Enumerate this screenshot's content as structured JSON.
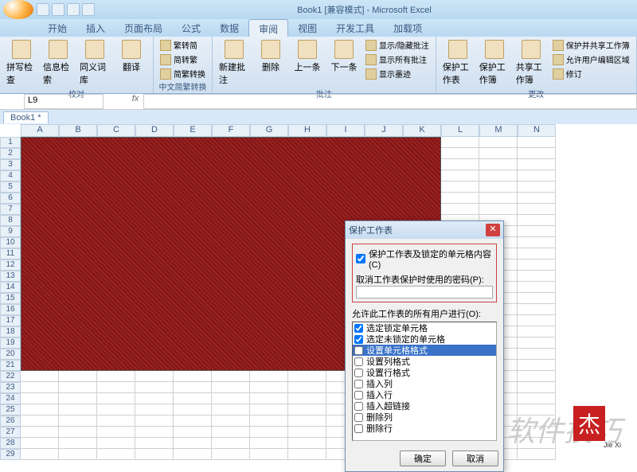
{
  "title": "Book1 [兼容模式] - Microsoft Excel",
  "tabs": [
    "开始",
    "插入",
    "页面布局",
    "公式",
    "数据",
    "审阅",
    "视图",
    "开发工具",
    "加载项"
  ],
  "active_tab": "审阅",
  "ribbon": {
    "group1": {
      "label": "校对",
      "btns": [
        "拼写检查",
        "信息检索",
        "同义词库",
        "翻译"
      ]
    },
    "group2": {
      "label": "中文简繁转换",
      "btns": [
        "繁转简",
        "简转繁",
        "简繁转换"
      ]
    },
    "group3": {
      "label": "批注",
      "big": [
        "新建批注",
        "删除",
        "上一条",
        "下一条"
      ],
      "small": [
        "显示/隐藏批注",
        "显示所有批注",
        "显示墨迹"
      ]
    },
    "group4": {
      "label": "更改",
      "big": [
        "保护工作表",
        "保护工作簿",
        "共享工作簿"
      ],
      "small": [
        "保护并共享工作簿",
        "允许用户编辑区域",
        "修订"
      ]
    }
  },
  "name_box": "L9",
  "workbook_tab": "Book1 *",
  "columns": [
    "A",
    "B",
    "C",
    "D",
    "E",
    "F",
    "G",
    "H",
    "I",
    "J",
    "K",
    "L",
    "M",
    "N"
  ],
  "rows": 29,
  "red_range": {
    "cols": 11,
    "rows": 21
  },
  "active_cell": "L9",
  "dialog": {
    "title": "保护工作表",
    "check_protect": "保护工作表及锁定的单元格内容(C)",
    "password_label": "取消工作表保护时使用的密码(P):",
    "allow_label": "允许此工作表的所有用户进行(O):",
    "options": [
      {
        "label": "选定锁定单元格",
        "checked": true
      },
      {
        "label": "选定未锁定的单元格",
        "checked": true
      },
      {
        "label": "设置单元格格式",
        "checked": false,
        "selected": true
      },
      {
        "label": "设置列格式",
        "checked": false
      },
      {
        "label": "设置行格式",
        "checked": false
      },
      {
        "label": "插入列",
        "checked": false
      },
      {
        "label": "插入行",
        "checked": false
      },
      {
        "label": "插入超链接",
        "checked": false
      },
      {
        "label": "删除列",
        "checked": false
      },
      {
        "label": "删除行",
        "checked": false
      }
    ],
    "ok": "确定",
    "cancel": "取消"
  },
  "watermark": "软件技巧",
  "logo": {
    "char": "杰",
    "sub": "Jie Xi"
  }
}
